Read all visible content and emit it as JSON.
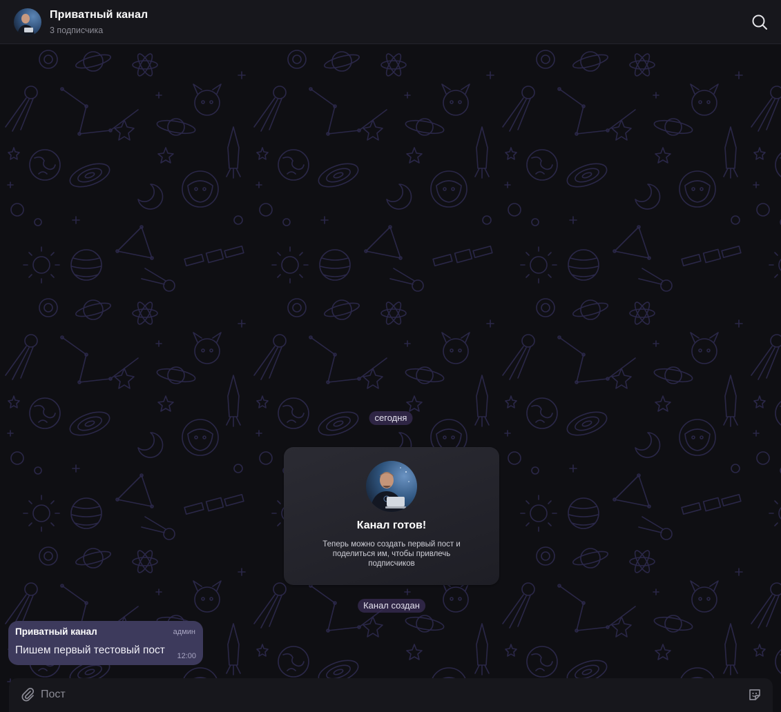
{
  "header": {
    "title": "Приватный канал",
    "subtitle": "3 подписчика",
    "avatar_icon": "channel-avatar-photo",
    "search_icon": "search-icon"
  },
  "chat": {
    "background_icon": "space-doodle-pattern",
    "date_pill": "сегодня",
    "service_card": {
      "avatar_icon": "channel-avatar-photo",
      "title": "Канал готов!",
      "text": "Теперь можно создать первый пост и поделиться им, чтобы привлечь подписчиков"
    },
    "created_pill": "Канал создан",
    "messages": [
      {
        "author": "Приватный канал",
        "role": "админ",
        "text": "Пишем первый тестовый пост",
        "time": "12:00"
      }
    ]
  },
  "composer": {
    "placeholder": "Пост",
    "attach_icon": "paperclip-icon",
    "sticker_icon": "sticker-icon"
  },
  "colors": {
    "background": "#0f0f13",
    "header": "#17171c",
    "pattern_stroke": "#2a2748",
    "bubble": "#3d3a5c",
    "pill": "#372c52",
    "accent_muted": "#8c8c96"
  }
}
